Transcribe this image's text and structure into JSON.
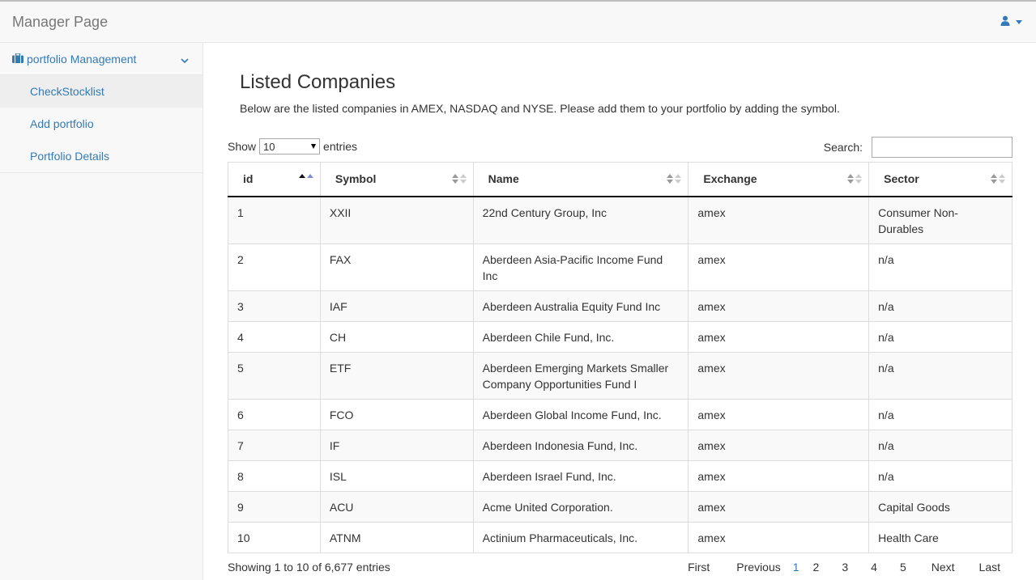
{
  "app": {
    "brand": "Manager Page"
  },
  "header": {
    "user_icon": "user-icon",
    "dropdown_icon": "caret-down-icon"
  },
  "sidebar": {
    "group_label": "portfolio Management",
    "group_icon": "briefcase-icon",
    "group_toggle_icon": "chevron-down-icon",
    "items": [
      {
        "label": "CheckStocklist",
        "active": true
      },
      {
        "label": "Add portfolio",
        "active": false
      },
      {
        "label": "Portfolio Details",
        "active": false
      }
    ]
  },
  "main": {
    "title": "Listed Companies",
    "description": "Below are the listed companies in AMEX, NASDAQ and NYSE. Please add them to your portfolio by adding the symbol."
  },
  "controls": {
    "show_label": "Show",
    "entries_label": "entries",
    "page_length": "10",
    "search_label": "Search:",
    "search_value": ""
  },
  "table": {
    "columns": [
      "id",
      "Symbol",
      "Name",
      "Exchange",
      "Sector"
    ],
    "sorted_column": "id",
    "sort_direction": "ascending",
    "rows": [
      [
        "1",
        "XXII",
        "22nd Century Group, Inc",
        "amex",
        "Consumer Non-Durables"
      ],
      [
        "2",
        "FAX",
        "Aberdeen Asia-Pacific Income Fund Inc",
        "amex",
        "n/a"
      ],
      [
        "3",
        "IAF",
        "Aberdeen Australia Equity Fund Inc",
        "amex",
        "n/a"
      ],
      [
        "4",
        "CH",
        "Aberdeen Chile Fund, Inc.",
        "amex",
        "n/a"
      ],
      [
        "5",
        "ETF",
        "Aberdeen Emerging Markets Smaller Company Opportunities Fund I",
        "amex",
        "n/a"
      ],
      [
        "6",
        "FCO",
        "Aberdeen Global Income Fund, Inc.",
        "amex",
        "n/a"
      ],
      [
        "7",
        "IF",
        "Aberdeen Indonesia Fund, Inc.",
        "amex",
        "n/a"
      ],
      [
        "8",
        "ISL",
        "Aberdeen Israel Fund, Inc.",
        "amex",
        "n/a"
      ],
      [
        "9",
        "ACU",
        "Acme United Corporation.",
        "amex",
        "Capital Goods"
      ],
      [
        "10",
        "ATNM",
        "Actinium Pharmaceuticals, Inc.",
        "amex",
        "Health Care"
      ]
    ]
  },
  "footer": {
    "info": "Showing 1 to 10 of 6,677 entries",
    "first": "First",
    "previous": "Previous",
    "pages": [
      "1",
      "2",
      "3",
      "4",
      "5"
    ],
    "current_page": "1",
    "next": "Next",
    "last": "Last"
  },
  "colors": {
    "link": "#337ab7",
    "sidebar_bg": "#f8f8f8",
    "stripe": "#f9f9f9",
    "sort_active": "#7b8ed6"
  }
}
